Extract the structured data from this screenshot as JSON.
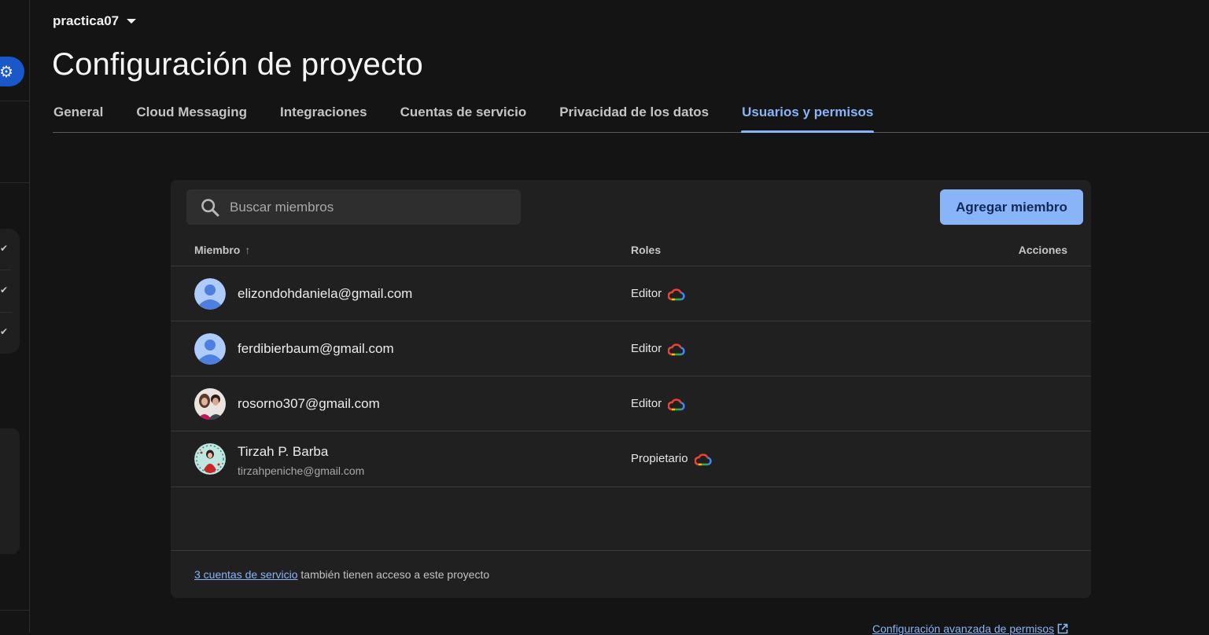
{
  "project": {
    "name": "practica07",
    "switch_icon": "caret-down-icon"
  },
  "page": {
    "title": "Configuración de proyecto"
  },
  "tabs": [
    {
      "label": "General",
      "active": false
    },
    {
      "label": "Cloud Messaging",
      "active": false
    },
    {
      "label": "Integraciones",
      "active": false
    },
    {
      "label": "Cuentas de servicio",
      "active": false
    },
    {
      "label": "Privacidad de los datos",
      "active": false
    },
    {
      "label": "Usuarios y permisos",
      "active": true
    }
  ],
  "search": {
    "placeholder": "Buscar miembros",
    "value": ""
  },
  "add_member": {
    "label": "Agregar miembro"
  },
  "table": {
    "col_member": "Miembro",
    "col_roles": "Roles",
    "col_actions": "Acciones",
    "sort": "ascending",
    "rows": [
      {
        "email": "elizondohdaniela@gmail.com",
        "name": "",
        "role": "Editor",
        "avatar": "default-avatar"
      },
      {
        "email": "ferdibierbaum@gmail.com",
        "name": "",
        "role": "Editor",
        "avatar": "default-avatar"
      },
      {
        "email": "rosorno307@gmail.com",
        "name": "",
        "role": "Editor",
        "avatar": "photo-avatar"
      },
      {
        "email": "tirzahpeniche@gmail.com",
        "name": "Tirzah P. Barba",
        "role": "Propietario",
        "avatar": "photo-avatar"
      }
    ]
  },
  "footer": {
    "link": "3 cuentas de servicio",
    "text": " también tienen acceso a este proyecto"
  },
  "advanced_link": {
    "label": "Configuración avanzada de permisos"
  },
  "colors": {
    "accent": "#8ab4f8",
    "background": "#141414",
    "card": "#202020",
    "rail_active": "#1a57c8"
  }
}
